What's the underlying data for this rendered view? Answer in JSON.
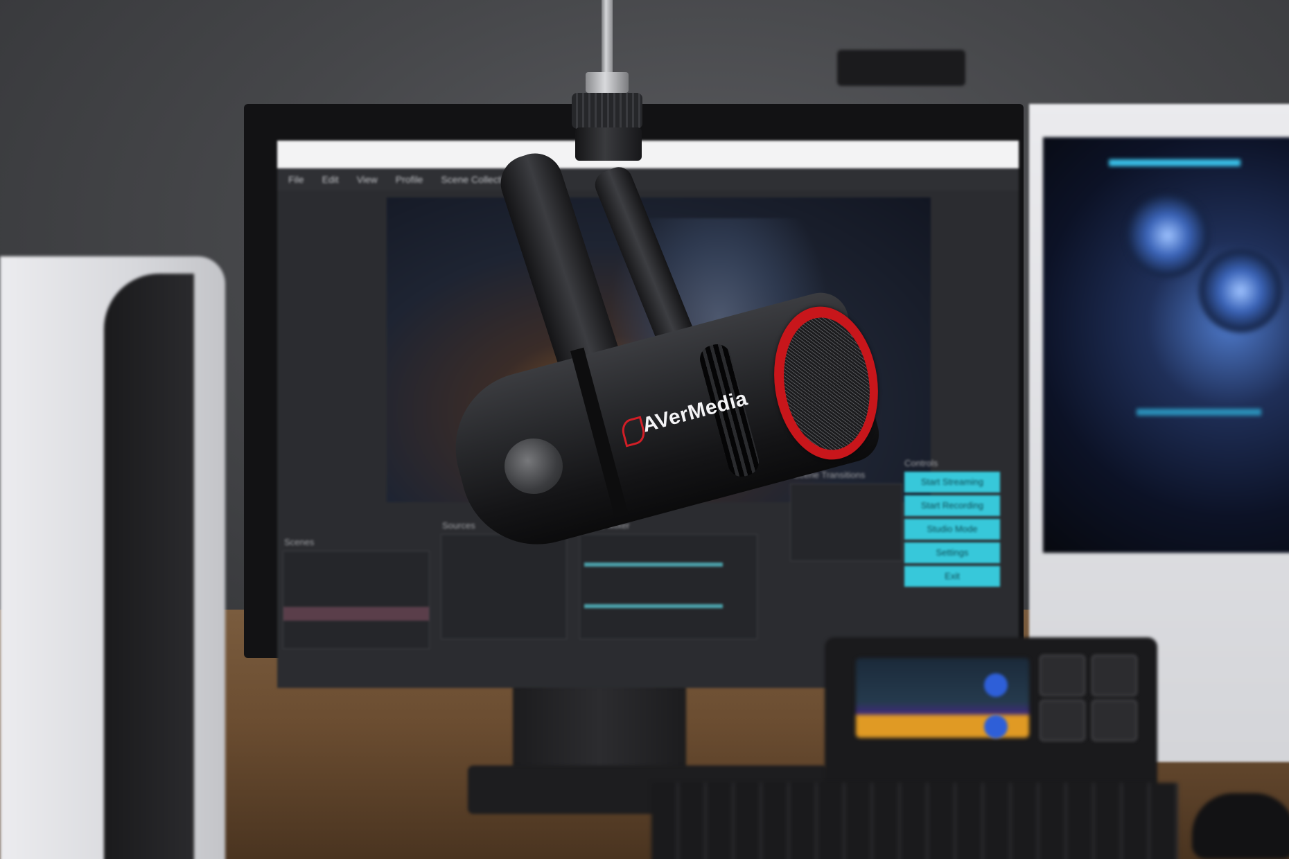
{
  "photo": {
    "subject": "microphone",
    "brand_text": "AVerMedia",
    "accent_colors": {
      "ring": "#c8161b",
      "screen_buttons": "#37c8da",
      "pc_light": "#39c0e8"
    }
  },
  "monitor_ui": {
    "menu_items": [
      "File",
      "Edit",
      "View",
      "Profile",
      "Scene Collection"
    ],
    "dock_labels": [
      "Scenes",
      "Sources",
      "Audio Mixer",
      "Scene Transitions",
      "Controls"
    ],
    "control_buttons": [
      "Start Streaming",
      "Start Recording",
      "Studio Mode",
      "Settings",
      "Exit"
    ]
  }
}
